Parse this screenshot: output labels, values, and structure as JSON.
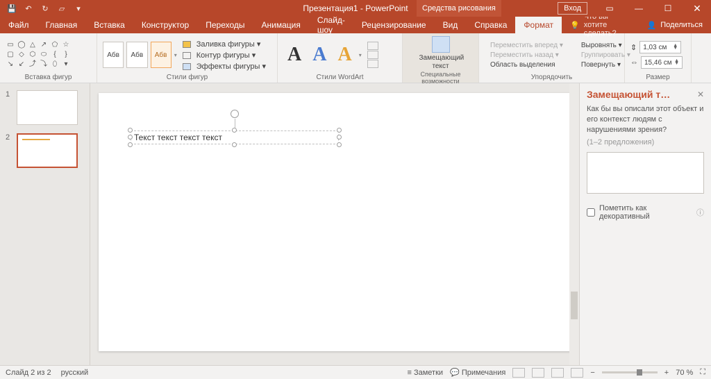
{
  "title": "Презентация1 - PowerPoint",
  "toolTab": "Средства рисования",
  "signin": "Вход",
  "menu": {
    "file": "Файл",
    "home": "Главная",
    "insert": "Вставка",
    "design": "Конструктор",
    "transitions": "Переходы",
    "animations": "Анимация",
    "slideshow": "Слайд-шоу",
    "review": "Рецензирование",
    "view": "Вид",
    "help": "Справка",
    "format": "Формат",
    "tell": "Что вы хотите сделать?",
    "share": "Поделиться"
  },
  "ribbon": {
    "insertShapes": "Вставка фигур",
    "shapeStyles": "Стили фигур",
    "stylesSample": "Абв",
    "shapeFill": "Заливка фигуры ▾",
    "shapeOutline": "Контур фигуры ▾",
    "shapeEffects": "Эффекты фигуры ▾",
    "wordArtStyles": "Стили WordArt",
    "waSample": "А",
    "accessibility": "Специальные возможности",
    "altText": "Замещающий текст",
    "arrange": "Упорядочить",
    "bringForward": "Переместить вперед ▾",
    "sendBackward": "Переместить назад ▾",
    "selectionPane": "Область выделения",
    "align": "Выровнять ▾",
    "group": "Группировать ▾",
    "rotate": "Повернуть ▾",
    "size": "Размер",
    "height": "1,03 см",
    "width": "15,46 см"
  },
  "thumbs": {
    "n1": "1",
    "n2": "2"
  },
  "slideText": "Текст текст текст текст",
  "pane": {
    "title": "Замещающий т…",
    "desc": "Как бы вы описали этот объект и его контекст людям с нарушениями зрения?",
    "hint": "(1–2 предложения)",
    "deco": "Пометить как декоративный"
  },
  "status": {
    "slide": "Слайд 2 из 2",
    "lang": "русский",
    "notes": "Заметки",
    "comments": "Примечания",
    "zoom": "70 %"
  }
}
